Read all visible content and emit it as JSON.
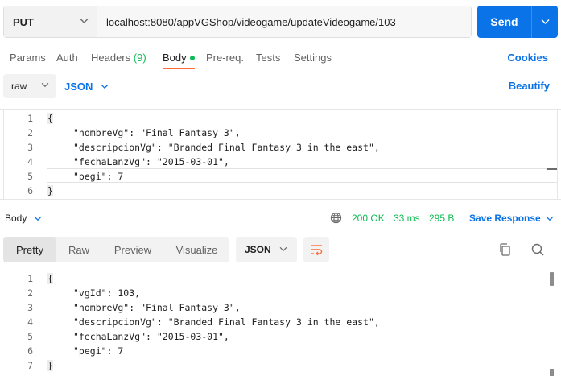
{
  "request": {
    "method": "PUT",
    "url": "localhost:8080/appVGShop/videogame/updateVideogame/103",
    "send_label": "Send"
  },
  "req_tabs": {
    "params": "Params",
    "auth": "Auth",
    "headers": "Headers",
    "headers_count": "(9)",
    "body": "Body",
    "prereq": "Pre-req.",
    "tests": "Tests",
    "settings": "Settings",
    "cookies": "Cookies"
  },
  "body_toolbar": {
    "mode": "raw",
    "language": "JSON",
    "beautify": "Beautify"
  },
  "request_body": {
    "line_numbers": [
      "1",
      "2",
      "3",
      "4",
      "5",
      "6"
    ],
    "lines": [
      "{",
      "\"nombreVg\": \"Final Fantasy 3\",",
      "\"descripcionVg\": \"Branded Final Fantasy 3 in the east\",",
      "\"fechaLanzVg\": \"2015-03-01\",",
      "\"pegi\": 7",
      "}"
    ]
  },
  "response_bar": {
    "body_label": "Body",
    "status": "200 OK",
    "time": "33 ms",
    "size": "295 B",
    "save_response": "Save Response"
  },
  "resp_tabs": {
    "pretty": "Pretty",
    "raw": "Raw",
    "preview": "Preview",
    "visualize": "Visualize",
    "format": "JSON"
  },
  "response_body": {
    "line_numbers": [
      "1",
      "2",
      "3",
      "4",
      "5",
      "6",
      "7"
    ],
    "lines": [
      "{",
      "\"vgId\": 103,",
      "\"nombreVg\": \"Final Fantasy 3\",",
      "\"descripcionVg\": \"Branded Final Fantasy 3 in the east\",",
      "\"fechaLanzVg\": \"2015-03-01\",",
      "\"pegi\": 7",
      "}"
    ]
  },
  "colors": {
    "accent": "#0b73e8",
    "success": "#0cbb52",
    "active_tab": "#ff6c37"
  },
  "icons": {
    "method_chevron": "chevron-down-icon",
    "send_chevron": "chevron-down-icon",
    "globe": "globe-icon",
    "wrap": "wrap-lines-icon",
    "copy": "copy-icon",
    "search": "search-icon"
  }
}
